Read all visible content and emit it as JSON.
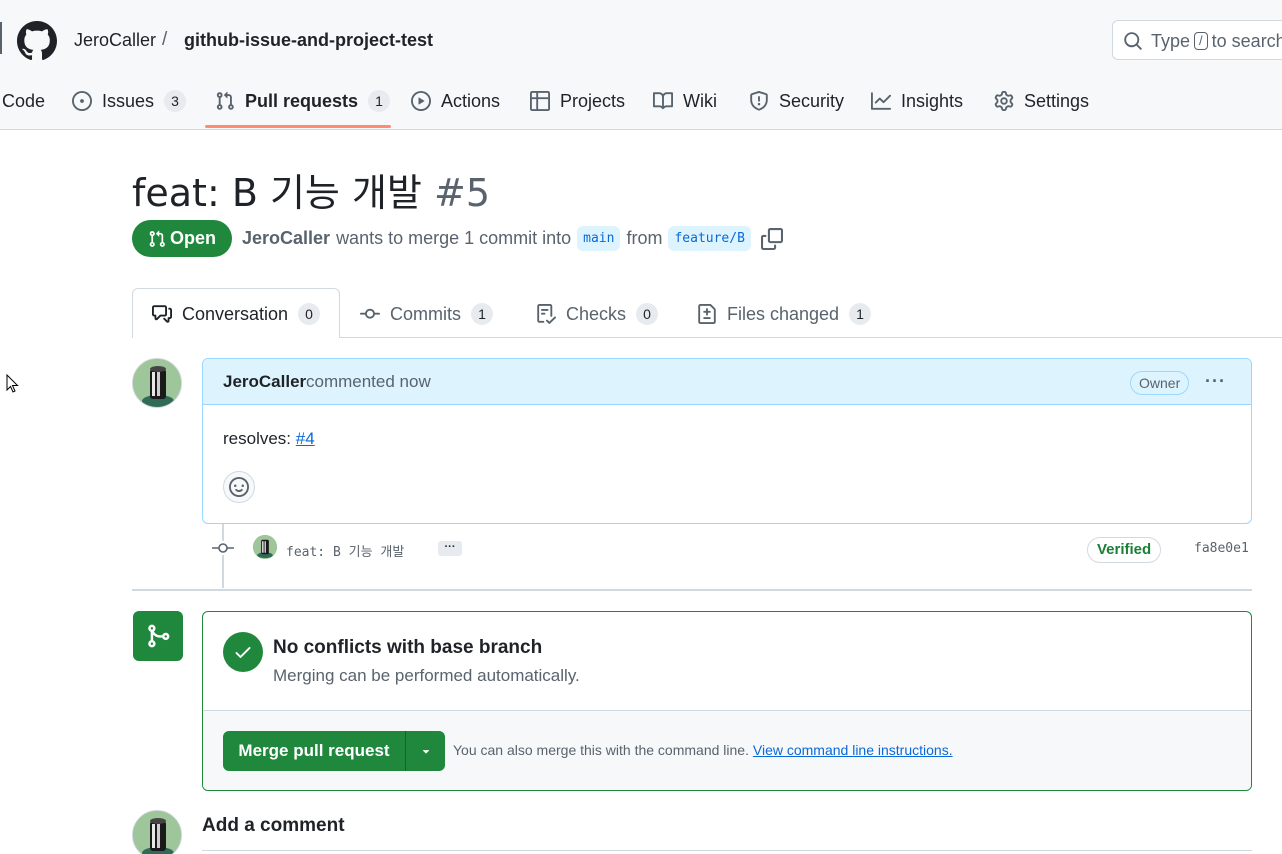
{
  "header": {
    "owner": "JeroCaller",
    "separator": "/",
    "repo": "github-issue-and-project-test",
    "search_placeholder_start": "Type",
    "search_key": "/",
    "search_placeholder_end": "to search"
  },
  "nav": [
    {
      "label": "Code",
      "icon": "code-icon"
    },
    {
      "label": "Issues",
      "count": "3",
      "icon": "issue-icon"
    },
    {
      "label": "Pull requests",
      "count": "1",
      "icon": "pull-request-icon",
      "selected": true
    },
    {
      "label": "Actions",
      "icon": "play-icon"
    },
    {
      "label": "Projects",
      "icon": "table-icon"
    },
    {
      "label": "Wiki",
      "icon": "book-icon"
    },
    {
      "label": "Security",
      "icon": "shield-icon"
    },
    {
      "label": "Insights",
      "icon": "graph-icon"
    },
    {
      "label": "Settings",
      "icon": "gear-icon"
    }
  ],
  "pr": {
    "title": "feat: B 기능 개발",
    "number": "#5",
    "state": "Open",
    "author": "JeroCaller",
    "merge_text": "wants to merge 1 commit into",
    "base_branch": "main",
    "from_text": "from",
    "head_branch": "feature/B"
  },
  "tabs": [
    {
      "label": "Conversation",
      "count": "0",
      "icon": "comment-discussion-icon",
      "active": true
    },
    {
      "label": "Commits",
      "count": "1",
      "icon": "commit-icon"
    },
    {
      "label": "Checks",
      "count": "0",
      "icon": "checklist-icon"
    },
    {
      "label": "Files changed",
      "count": "1",
      "icon": "file-diff-icon"
    }
  ],
  "comment": {
    "author": "JeroCaller",
    "time": "commented now",
    "role": "Owner",
    "more": "···",
    "body_text": "resolves:",
    "body_link": "#4"
  },
  "commit": {
    "message": "feat: B 기능 개발",
    "more": "···",
    "verified": "Verified",
    "sha": "fa8e0e1"
  },
  "merge": {
    "title": "No conflicts with base branch",
    "subtitle": "Merging can be performed automatically.",
    "button": "Merge pull request",
    "hint": "You can also merge this with the command line.",
    "hint_link": "View command line instructions."
  },
  "add_comment": {
    "title": "Add a comment"
  },
  "colors": {
    "accent_green": "#1f883d",
    "link_blue": "#0969da",
    "tab_underline": "#fd8c73"
  }
}
